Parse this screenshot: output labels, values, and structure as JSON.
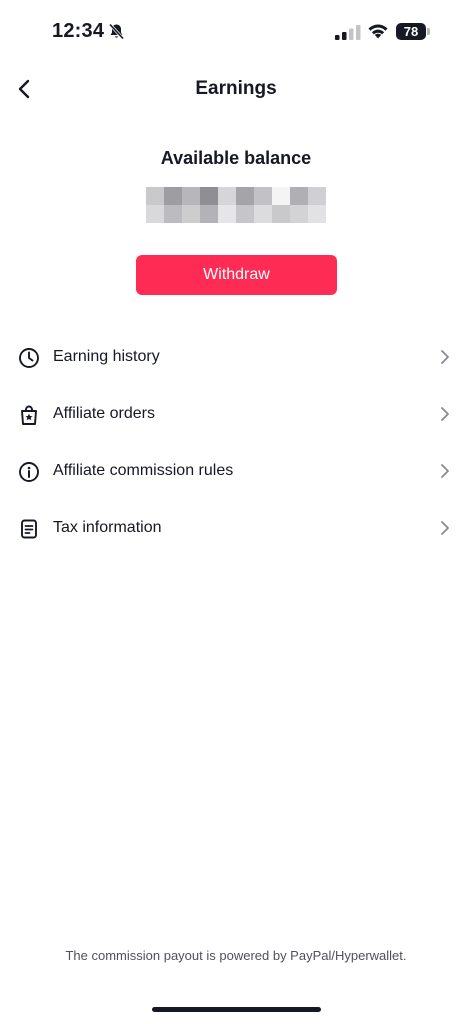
{
  "status_bar": {
    "time": "12:34",
    "battery": "78",
    "icons": [
      "bell-slash-icon",
      "signal-icon",
      "wifi-icon",
      "battery-icon"
    ]
  },
  "header": {
    "title": "Earnings",
    "back_icon": "chevron-left-icon"
  },
  "balance": {
    "label": "Available balance",
    "value": ""
  },
  "withdraw_label": "Withdraw",
  "menu": [
    {
      "label": "Earning history",
      "icon": "clock-icon"
    },
    {
      "label": "Affiliate orders",
      "icon": "shopping-bag-star-icon"
    },
    {
      "label": "Affiliate commission rules",
      "icon": "info-icon"
    },
    {
      "label": "Tax information",
      "icon": "document-icon"
    }
  ],
  "footer": "The commission payout is powered by PayPal/Hyperwallet.",
  "colors": {
    "accent": "#fe2c55",
    "text": "#161823",
    "secondary_text": "#50525a"
  }
}
